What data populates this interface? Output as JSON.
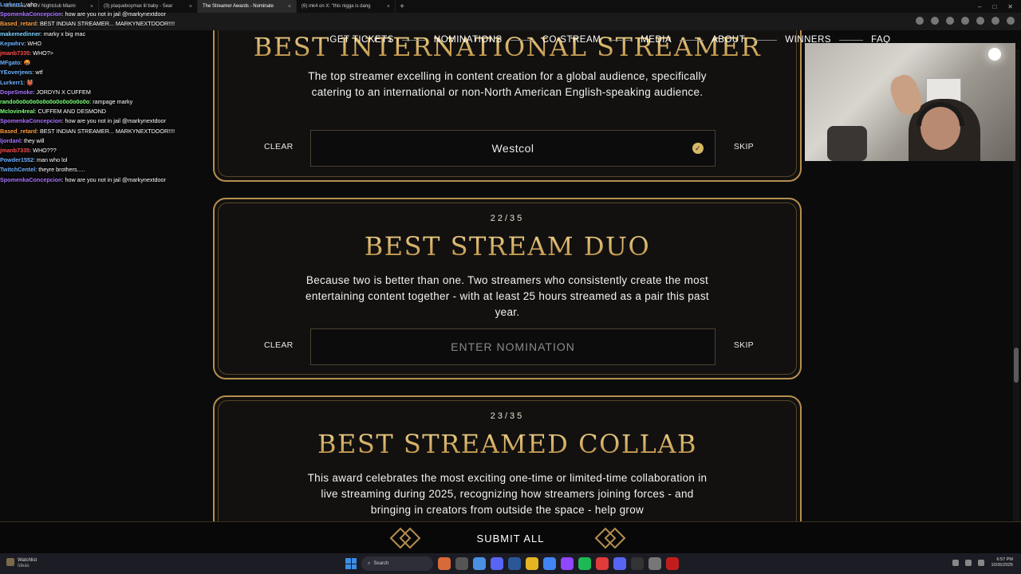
{
  "browser": {
    "tabs": [
      {
        "title": "Shenseea at LIV Nightclub Miami",
        "active": false
      },
      {
        "title": "(3) plaqueboymax lil baby - Sear",
        "active": false
      },
      {
        "title": "The Streamer Awards - Nominate",
        "active": true
      },
      {
        "title": "(6) mk4 on X: \"this nigga is dang",
        "active": false
      }
    ],
    "new_tab": "+",
    "close_glyph": "×",
    "window_controls": [
      "–",
      "□",
      "✕"
    ]
  },
  "chat": [
    {
      "user": "Lurkerr1",
      "color": "#6ab0ff",
      "msg": "who"
    },
    {
      "user": "SpomenkaConcepcion",
      "color": "#a970ff",
      "msg": "how are you not in jail @markynextdoor"
    },
    {
      "user": "Based_retard",
      "color": "#ff9b3a",
      "msg": "BEST INDIAN STREAMER... MARKYNEXTDOOR!!!!"
    },
    {
      "user": "makemedinner",
      "color": "#7ad3ff",
      "msg": "marky x big mac"
    },
    {
      "user": "Kepwhrv",
      "color": "#6ab0ff",
      "msg": "WHO"
    },
    {
      "user": "jmanb7335",
      "color": "#ff4d4d",
      "msg": "WHO?>"
    },
    {
      "user": "MFgato",
      "color": "#6ab0ff",
      "msg": "🤬"
    },
    {
      "user": "YEoverjews",
      "color": "#6ab0ff",
      "msg": "wtf"
    },
    {
      "user": "Lurkerr1",
      "color": "#6ab0ff",
      "msg": "👹"
    },
    {
      "user": "DopeSmoke",
      "color": "#a970ff",
      "msg": "JORDYN X CUFFEM"
    },
    {
      "user": "rando0o0o0o0o0o0o0o0o0o0o0o",
      "color": "#7dff7d",
      "msg": "rampage marky"
    },
    {
      "user": "Mclovin4real",
      "color": "#7dff7d",
      "msg": "CUFFEM AND DESMOND"
    },
    {
      "user": "SpomenkaConcepcion",
      "color": "#a970ff",
      "msg": "how are you not in jail @markynextdoor"
    },
    {
      "user": "Based_retard",
      "color": "#ff9b3a",
      "msg": "BEST INDIAN STREAMER... MARKYNEXTDOOR!!!!"
    },
    {
      "user": "ljordanl",
      "color": "#a970ff",
      "msg": "they will"
    },
    {
      "user": "jmanb7335",
      "color": "#ff4d4d",
      "msg": "WHO???"
    },
    {
      "user": "Powder1552",
      "color": "#6ab0ff",
      "msg": "man who lol"
    },
    {
      "user": "TwitchCentel",
      "color": "#6ab0ff",
      "msg": "theyre brothers....."
    },
    {
      "user": "SpomenkaConcepcion",
      "color": "#a970ff",
      "msg": "how are you not in jail @markynextdoor"
    }
  ],
  "nav": {
    "items": [
      "GET TICKETS",
      "NOMINATIONS",
      "CO-STREAM",
      "MEDIA",
      "ABOUT",
      "WINNERS",
      "FAQ"
    ]
  },
  "categories": [
    {
      "counter": "",
      "title": "BEST INTERNATIONAL STREAMER",
      "description": "The top streamer excelling in content creation for a global audience, specifically catering to an international or non-North American English-speaking audience.",
      "nomination": "Westcol",
      "confirmed": true,
      "clear_label": "CLEAR",
      "skip_label": "SKIP"
    },
    {
      "counter": "22/35",
      "title": "BEST STREAM DUO",
      "description": "Because two is better than one. Two streamers who consistently create the most entertaining content together - with at least 25 hours streamed as a pair this past year.",
      "placeholder": "ENTER NOMINATION",
      "clear_label": "CLEAR",
      "skip_label": "SKIP"
    },
    {
      "counter": "23/35",
      "title": "BEST STREAMED COLLAB",
      "description": "This award celebrates the most exciting one-time or limited-time collaboration in live streaming during 2025, recognizing how streamers joining forces - and bringing in creators from outside the space - help grow"
    }
  ],
  "submit": {
    "label": "SUBMIT ALL"
  },
  "taskbar": {
    "weather_title": "Watchlist",
    "weather_sub": "Ideas",
    "search_label": "Search",
    "time": "6:57 PM",
    "date": "10/26/2025"
  },
  "icons": {
    "check": "✓",
    "search": "⌕"
  },
  "colors": {
    "gold": "#b68f4e",
    "title_gold": "#d9b56a",
    "background": "#0b0b0b"
  }
}
